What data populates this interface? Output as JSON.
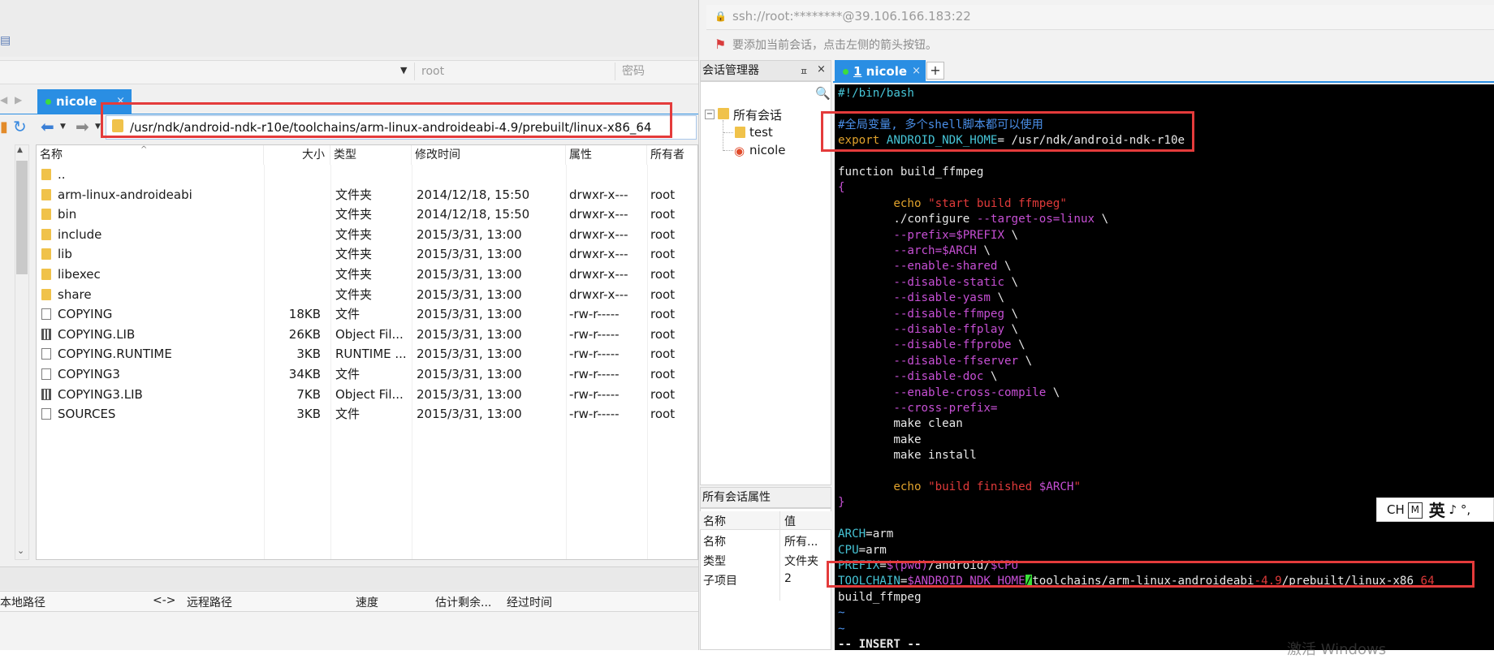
{
  "left": {
    "connection": {
      "user_placeholder": "root",
      "password_placeholder": "密码"
    },
    "tab": {
      "label": "nicole",
      "close": "×"
    },
    "path": "/usr/ndk/android-ndk-r10e/toolchains/arm-linux-androideabi-4.9/prebuilt/linux-x86_64",
    "columns": {
      "name": "名称",
      "size": "大小",
      "type": "类型",
      "mtime": "修改时间",
      "attr": "属性",
      "owner": "所有者"
    },
    "files": [
      {
        "icon": "folder-icon",
        "name": "..",
        "size": "",
        "type": "",
        "mtime": "",
        "attr": "",
        "owner": ""
      },
      {
        "icon": "folder-icon",
        "name": "arm-linux-androideabi",
        "size": "",
        "type": "文件夹",
        "mtime": "2014/12/18, 15:50",
        "attr": "drwxr-x---",
        "owner": "root"
      },
      {
        "icon": "folder-icon",
        "name": "bin",
        "size": "",
        "type": "文件夹",
        "mtime": "2014/12/18, 15:50",
        "attr": "drwxr-x---",
        "owner": "root"
      },
      {
        "icon": "folder-icon",
        "name": "include",
        "size": "",
        "type": "文件夹",
        "mtime": "2015/3/31, 13:00",
        "attr": "drwxr-x---",
        "owner": "root"
      },
      {
        "icon": "folder-icon",
        "name": "lib",
        "size": "",
        "type": "文件夹",
        "mtime": "2015/3/31, 13:00",
        "attr": "drwxr-x---",
        "owner": "root"
      },
      {
        "icon": "folder-icon",
        "name": "libexec",
        "size": "",
        "type": "文件夹",
        "mtime": "2015/3/31, 13:00",
        "attr": "drwxr-x---",
        "owner": "root"
      },
      {
        "icon": "folder-icon",
        "name": "share",
        "size": "",
        "type": "文件夹",
        "mtime": "2015/3/31, 13:00",
        "attr": "drwxr-x---",
        "owner": "root"
      },
      {
        "icon": "file-icon",
        "name": "COPYING",
        "size": "18KB",
        "type": "文件",
        "mtime": "2015/3/31, 13:00",
        "attr": "-rw-r-----",
        "owner": "root"
      },
      {
        "icon": "library-file-icon",
        "name": "COPYING.LIB",
        "size": "26KB",
        "type": "Object Fil...",
        "mtime": "2015/3/31, 13:00",
        "attr": "-rw-r-----",
        "owner": "root"
      },
      {
        "icon": "file-icon",
        "name": "COPYING.RUNTIME",
        "size": "3KB",
        "type": "RUNTIME ...",
        "mtime": "2015/3/31, 13:00",
        "attr": "-rw-r-----",
        "owner": "root"
      },
      {
        "icon": "file-icon",
        "name": "COPYING3",
        "size": "34KB",
        "type": "文件",
        "mtime": "2015/3/31, 13:00",
        "attr": "-rw-r-----",
        "owner": "root"
      },
      {
        "icon": "library-file-icon",
        "name": "COPYING3.LIB",
        "size": "7KB",
        "type": "Object Fil...",
        "mtime": "2015/3/31, 13:00",
        "attr": "-rw-r-----",
        "owner": "root"
      },
      {
        "icon": "file-icon",
        "name": "SOURCES",
        "size": "3KB",
        "type": "文件",
        "mtime": "2015/3/31, 13:00",
        "attr": "-rw-r-----",
        "owner": "root"
      }
    ],
    "transfer_columns": {
      "local": "本地路径",
      "dir": "<->",
      "remote": "远程路径",
      "speed": "速度",
      "eta": "估计剩余...",
      "elapsed": "经过时间"
    }
  },
  "right": {
    "address": "ssh://root:********@39.106.166.183:22",
    "hint": "要添加当前会话，点击左侧的箭头按钮。",
    "session_manager": {
      "title": "会话管理器",
      "pin": "ㅍ",
      "close": "×",
      "root": "所有会话",
      "children": [
        "test",
        "nicole"
      ]
    },
    "properties": {
      "title": "所有会话属性",
      "col_name": "名称",
      "col_value": "值",
      "rows": [
        {
          "k": "名称",
          "v": "所有..."
        },
        {
          "k": "类型",
          "v": "文件夹"
        },
        {
          "k": "子项目",
          "v": "2"
        }
      ]
    },
    "terminal_tab": {
      "number": "1",
      "label": "nicole",
      "close": "×",
      "add": "+"
    },
    "terminal_lines": [
      [
        [
          "cy",
          "#!/bin/bash"
        ]
      ],
      [
        [
          "w",
          ""
        ]
      ],
      [
        [
          "bl",
          "#全局变量, 多个shell脚本都可以使用"
        ]
      ],
      [
        [
          "or",
          "export "
        ],
        [
          "cy",
          "ANDROID_NDK_HOME"
        ],
        [
          "w",
          "= /usr/ndk/android-ndk-r10e"
        ]
      ],
      [
        [
          "w",
          ""
        ]
      ],
      [
        [
          "w",
          "function build_ffmpeg"
        ]
      ],
      [
        [
          "mg",
          "{"
        ]
      ],
      [
        [
          "w",
          "        "
        ],
        [
          "or",
          "echo "
        ],
        [
          "rd",
          "\"start build ffmpeg\""
        ]
      ],
      [
        [
          "w",
          "        ./configure "
        ],
        [
          "mg",
          "--target-os=linux"
        ],
        [
          "w",
          " \\"
        ]
      ],
      [
        [
          "w",
          "        "
        ],
        [
          "mg",
          "--prefix=$PREFIX"
        ],
        [
          "w",
          " \\"
        ]
      ],
      [
        [
          "w",
          "        "
        ],
        [
          "mg",
          "--arch=$ARCH"
        ],
        [
          "w",
          " \\"
        ]
      ],
      [
        [
          "w",
          "        "
        ],
        [
          "mg",
          "--enable-shared"
        ],
        [
          "w",
          " \\"
        ]
      ],
      [
        [
          "w",
          "        "
        ],
        [
          "mg",
          "--disable-static"
        ],
        [
          "w",
          " \\"
        ]
      ],
      [
        [
          "w",
          "        "
        ],
        [
          "mg",
          "--disable-yasm"
        ],
        [
          "w",
          " \\"
        ]
      ],
      [
        [
          "w",
          "        "
        ],
        [
          "mg",
          "--disable-ffmpeg"
        ],
        [
          "w",
          " \\"
        ]
      ],
      [
        [
          "w",
          "        "
        ],
        [
          "mg",
          "--disable-ffplay"
        ],
        [
          "w",
          " \\"
        ]
      ],
      [
        [
          "w",
          "        "
        ],
        [
          "mg",
          "--disable-ffprobe"
        ],
        [
          "w",
          " \\"
        ]
      ],
      [
        [
          "w",
          "        "
        ],
        [
          "mg",
          "--disable-ffserver"
        ],
        [
          "w",
          " \\"
        ]
      ],
      [
        [
          "w",
          "        "
        ],
        [
          "mg",
          "--disable-doc"
        ],
        [
          "w",
          " \\"
        ]
      ],
      [
        [
          "w",
          "        "
        ],
        [
          "mg",
          "--enable-cross-compile"
        ],
        [
          "w",
          " \\"
        ]
      ],
      [
        [
          "w",
          "        "
        ],
        [
          "mg",
          "--cross-prefix="
        ]
      ],
      [
        [
          "w",
          "        make clean"
        ]
      ],
      [
        [
          "w",
          "        make"
        ]
      ],
      [
        [
          "w",
          "        make install"
        ]
      ],
      [
        [
          "w",
          ""
        ]
      ],
      [
        [
          "w",
          "        "
        ],
        [
          "or",
          "echo "
        ],
        [
          "rd",
          "\"build finished "
        ],
        [
          "mg",
          "$ARCH"
        ],
        [
          "rd",
          "\""
        ]
      ],
      [
        [
          "mg",
          "}"
        ]
      ],
      [
        [
          "w",
          ""
        ]
      ],
      [
        [
          "cy",
          "ARCH"
        ],
        [
          "w",
          "=arm"
        ]
      ],
      [
        [
          "cy",
          "CPU"
        ],
        [
          "w",
          "=arm"
        ]
      ],
      [
        [
          "cy",
          "PREFIX"
        ],
        [
          "w",
          "="
        ],
        [
          "mg",
          "$(pwd)"
        ],
        [
          "w",
          "/android/"
        ],
        [
          "mg",
          "$CPU"
        ]
      ],
      [
        [
          "cy",
          "TOOLCHAIN"
        ],
        [
          "w",
          "="
        ],
        [
          "mg",
          "$ANDROID_NDK_HOME"
        ],
        [
          "cursor",
          "/"
        ],
        [
          "w",
          "toolchains/arm-linux-androideabi"
        ],
        [
          "rd",
          "-4.9"
        ],
        [
          "w",
          "/prebuilt/linux-x86_"
        ],
        [
          "rd",
          "64"
        ]
      ],
      [
        [
          "w",
          "build_ffmpeg"
        ]
      ],
      [
        [
          "bl",
          "~"
        ]
      ],
      [
        [
          "bl",
          "~"
        ]
      ],
      [
        [
          "w bold",
          "-- INSERT --"
        ]
      ]
    ],
    "ime": {
      "ch": "CH",
      "m": "M",
      "lang": "英",
      "extra": "♪ °,"
    },
    "watermark": "激活 Windows"
  }
}
